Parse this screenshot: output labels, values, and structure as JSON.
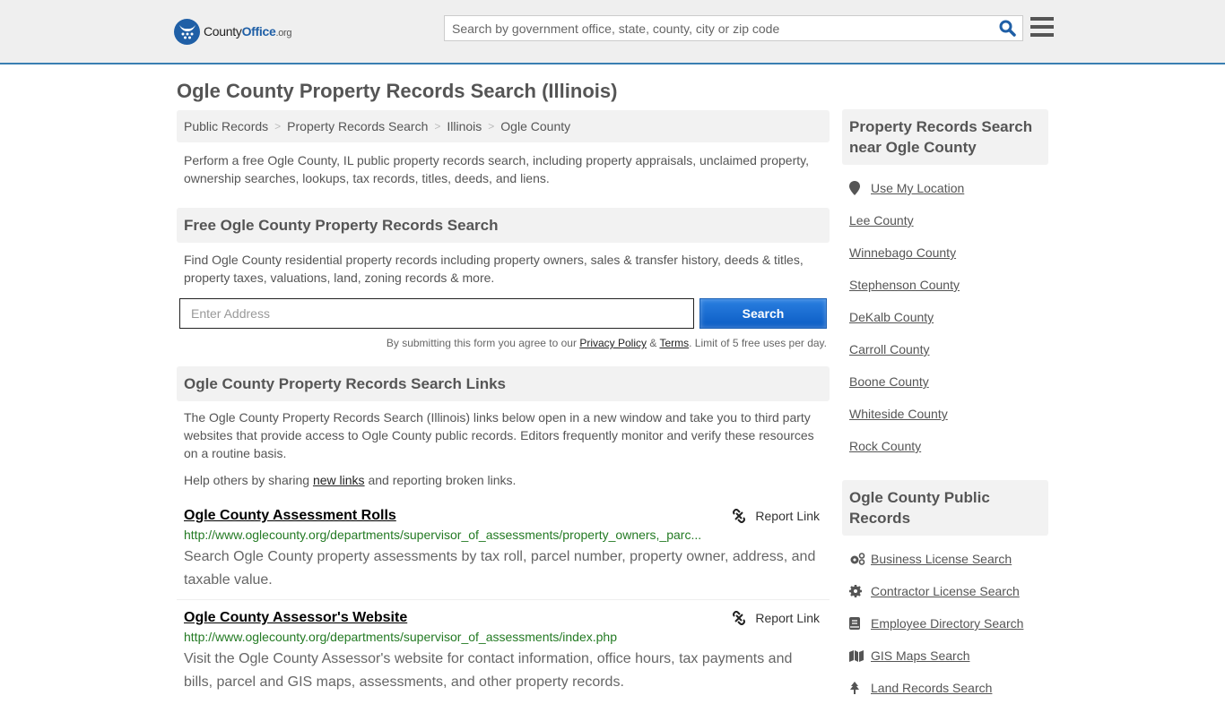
{
  "header": {
    "logo": {
      "part1": "County",
      "part2": "Office",
      "part3": ".org"
    },
    "search_placeholder": "Search by government office, state, county, city or zip code",
    "search_icon": "search-icon",
    "menu_icon": "hamburger-menu-icon",
    "accent_color": "#3a7fb2"
  },
  "page": {
    "title": "Ogle County Property Records Search (Illinois)",
    "breadcrumb": [
      "Public Records",
      "Property Records Search",
      "Illinois",
      "Ogle County"
    ],
    "intro": "Perform a free Ogle County, IL public property records search, including property appraisals, unclaimed property, ownership searches, lookups, tax records, titles, deeds, and liens."
  },
  "free_search": {
    "heading": "Free Ogle County Property Records Search",
    "description": "Find Ogle County residential property records including property owners, sales & transfer history, deeds & titles, property taxes, valuations, land, zoning records & more.",
    "address_placeholder": "Enter Address",
    "address_value": "",
    "button_label": "Search",
    "terms_prefix": "By submitting this form you agree to our ",
    "privacy_label": "Privacy Policy",
    "amp": " & ",
    "terms_label": "Terms",
    "terms_suffix": ". Limit of 5 free uses per day."
  },
  "links_section": {
    "heading": "Ogle County Property Records Search Links",
    "description": "The Ogle County Property Records Search (Illinois) links below open in a new window and take you to third party websites that provide access to Ogle County public records. Editors frequently monitor and verify these resources on a routine basis.",
    "help_prefix": "Help others by sharing ",
    "help_link": "new links",
    "help_suffix": " and reporting broken links.",
    "report_label": "Report Link",
    "items": [
      {
        "title": "Ogle County Assessment Rolls",
        "url": "http://www.oglecounty.org/departments/supervisor_of_assessments/property_owners,_parc...",
        "description": "Search Ogle County property assessments by tax roll, parcel number, property owner, address, and taxable value."
      },
      {
        "title": "Ogle County Assessor's Website",
        "url": "http://www.oglecounty.org/departments/supervisor_of_assessments/index.php",
        "description": "Visit the Ogle County Assessor's website for contact information, office hours, tax payments and bills, parcel and GIS maps, assessments, and other property records."
      }
    ]
  },
  "sidebar": {
    "nearby": {
      "heading": "Property Records Search near Ogle County",
      "use_location": "Use My Location",
      "counties": [
        "Lee County",
        "Winnebago County",
        "Stephenson County",
        "DeKalb County",
        "Carroll County",
        "Boone County",
        "Whiteside County",
        "Rock County"
      ]
    },
    "public_records": {
      "heading": "Ogle County Public Records",
      "items": [
        {
          "label": "Business License Search",
          "icon": "cogs-icon"
        },
        {
          "label": "Contractor License Search",
          "icon": "gear-icon"
        },
        {
          "label": "Employee Directory Search",
          "icon": "book-icon"
        },
        {
          "label": "GIS Maps Search",
          "icon": "map-icon"
        },
        {
          "label": "Land Records Search",
          "icon": "tree-icon"
        }
      ]
    }
  }
}
